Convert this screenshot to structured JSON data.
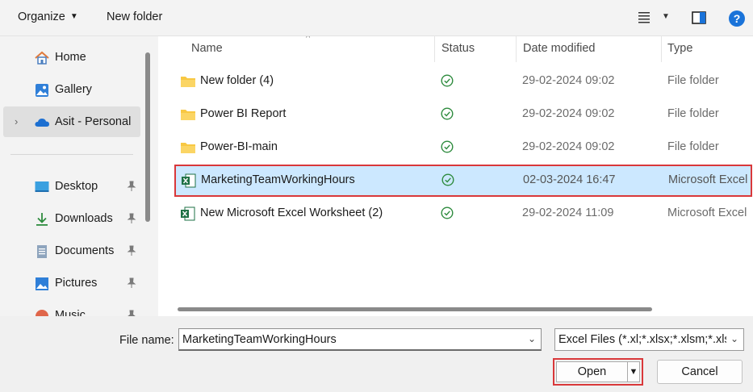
{
  "toolbar": {
    "organize_label": "Organize",
    "new_folder_label": "New folder",
    "help_label": "?"
  },
  "nav": {
    "items": [
      {
        "label": "Home",
        "icon": "home-icon"
      },
      {
        "label": "Gallery",
        "icon": "gallery-icon"
      },
      {
        "label": "Asit - Personal",
        "icon": "onedrive-cloud-icon",
        "selected": true
      },
      {
        "label": "Desktop",
        "icon": "desktop-icon",
        "pinned": true
      },
      {
        "label": "Downloads",
        "icon": "download-icon",
        "pinned": true
      },
      {
        "label": "Documents",
        "icon": "documents-icon",
        "pinned": true
      },
      {
        "label": "Pictures",
        "icon": "pictures-icon",
        "pinned": true
      },
      {
        "label": "Music",
        "icon": "music-icon",
        "pinned": true
      }
    ]
  },
  "columns": {
    "name": "Name",
    "status": "Status",
    "date": "Date modified",
    "type": "Type"
  },
  "files": [
    {
      "name": "New folder (4)",
      "date": "29-02-2024 09:02",
      "type": "File folder",
      "kind": "folder"
    },
    {
      "name": "Power BI Report",
      "date": "29-02-2024 09:02",
      "type": "File folder",
      "kind": "folder"
    },
    {
      "name": "Power-BI-main",
      "date": "29-02-2024 09:02",
      "type": "File folder",
      "kind": "folder"
    },
    {
      "name": "MarketingTeamWorkingHours",
      "date": "02-03-2024 16:47",
      "type": "Microsoft Excel",
      "kind": "excel",
      "selected": true
    },
    {
      "name": "New Microsoft Excel Worksheet (2)",
      "date": "29-02-2024 11:09",
      "type": "Microsoft Excel",
      "kind": "excel"
    }
  ],
  "footer": {
    "file_name_label": "File name:",
    "file_name_value": "MarketingTeamWorkingHours",
    "file_type_value": "Excel Files (*.xl;*.xlsx;*.xlsm;*.xlsb",
    "open_label": "Open",
    "cancel_label": "Cancel"
  },
  "colors": {
    "accent_blue": "#1a73d9",
    "selection": "#cce8ff",
    "highlight_red": "#d9383a",
    "folder_yellow": "#f8c843",
    "excel_green": "#1d7044",
    "status_green": "#2e8b3e"
  }
}
